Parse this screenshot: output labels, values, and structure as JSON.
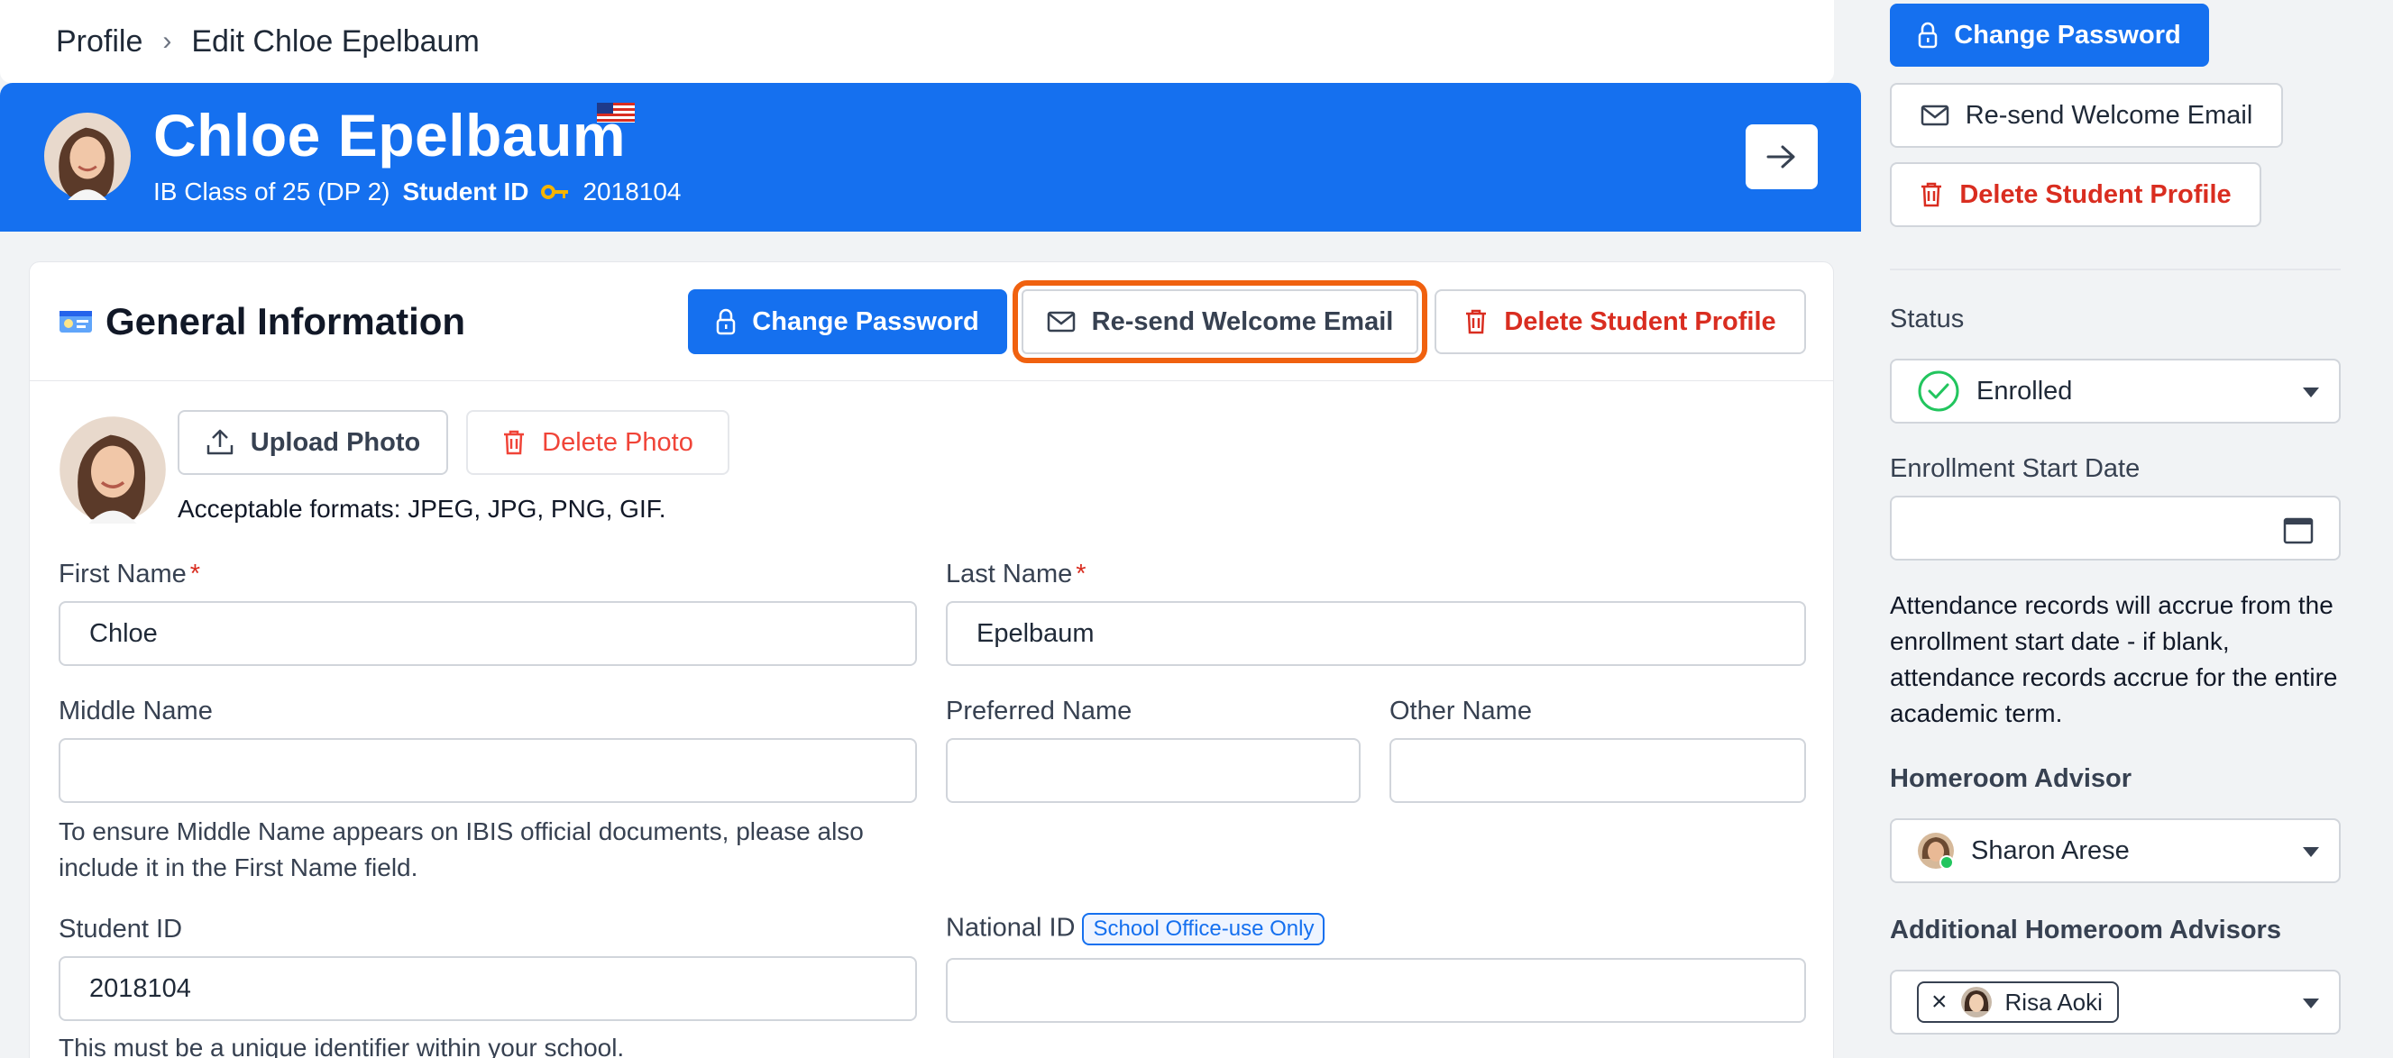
{
  "breadcrumb": {
    "root": "Profile",
    "separator": "›",
    "current": "Edit Chloe Epelbaum"
  },
  "hero": {
    "name": "Chloe Epelbaum",
    "class_info": "IB Class of 25 (DP 2)",
    "student_id_label": "Student ID",
    "student_id": "2018104"
  },
  "general": {
    "title": "General Information",
    "change_password": "Change Password",
    "resend_email": "Re-send Welcome Email",
    "delete_profile": "Delete Student Profile",
    "upload_photo": "Upload Photo",
    "delete_photo": "Delete Photo",
    "photo_formats": "Acceptable formats: JPEG, JPG, PNG, GIF.",
    "first_name_label": "First Name",
    "first_name": "Chloe",
    "last_name_label": "Last Name",
    "last_name": "Epelbaum",
    "required_mark": "*",
    "middle_name_label": "Middle Name",
    "preferred_name_label": "Preferred Name",
    "other_name_label": "Other Name",
    "middle_name_help": "To ensure Middle Name appears on IBIS official documents, please also include it in the First Name field.",
    "student_id_label": "Student ID",
    "student_id": "2018104",
    "national_id_label": "National ID",
    "national_id_tag": "School Office-use Only",
    "student_id_help": "This must be a unique identifier within your school."
  },
  "sidebar": {
    "change_password": "Change Password",
    "resend_email": "Re-send Welcome Email",
    "delete_profile": "Delete Student Profile",
    "status_label": "Status",
    "status_value": "Enrolled",
    "enrollment_label": "Enrollment Start Date",
    "enrollment_help": "Attendance records will accrue from the enrollment start date - if blank, attendance records accrue for the entire academic term.",
    "homeroom_label": "Homeroom Advisor",
    "homeroom_value": "Sharon Arese",
    "additional_label": "Additional Homeroom Advisors",
    "additional_chip": "Risa Aoki",
    "chip_remove": "×"
  },
  "colors": {
    "primary": "#1570ef",
    "danger": "#d92d20",
    "highlight": "#f0610f",
    "success": "#22c55e"
  }
}
